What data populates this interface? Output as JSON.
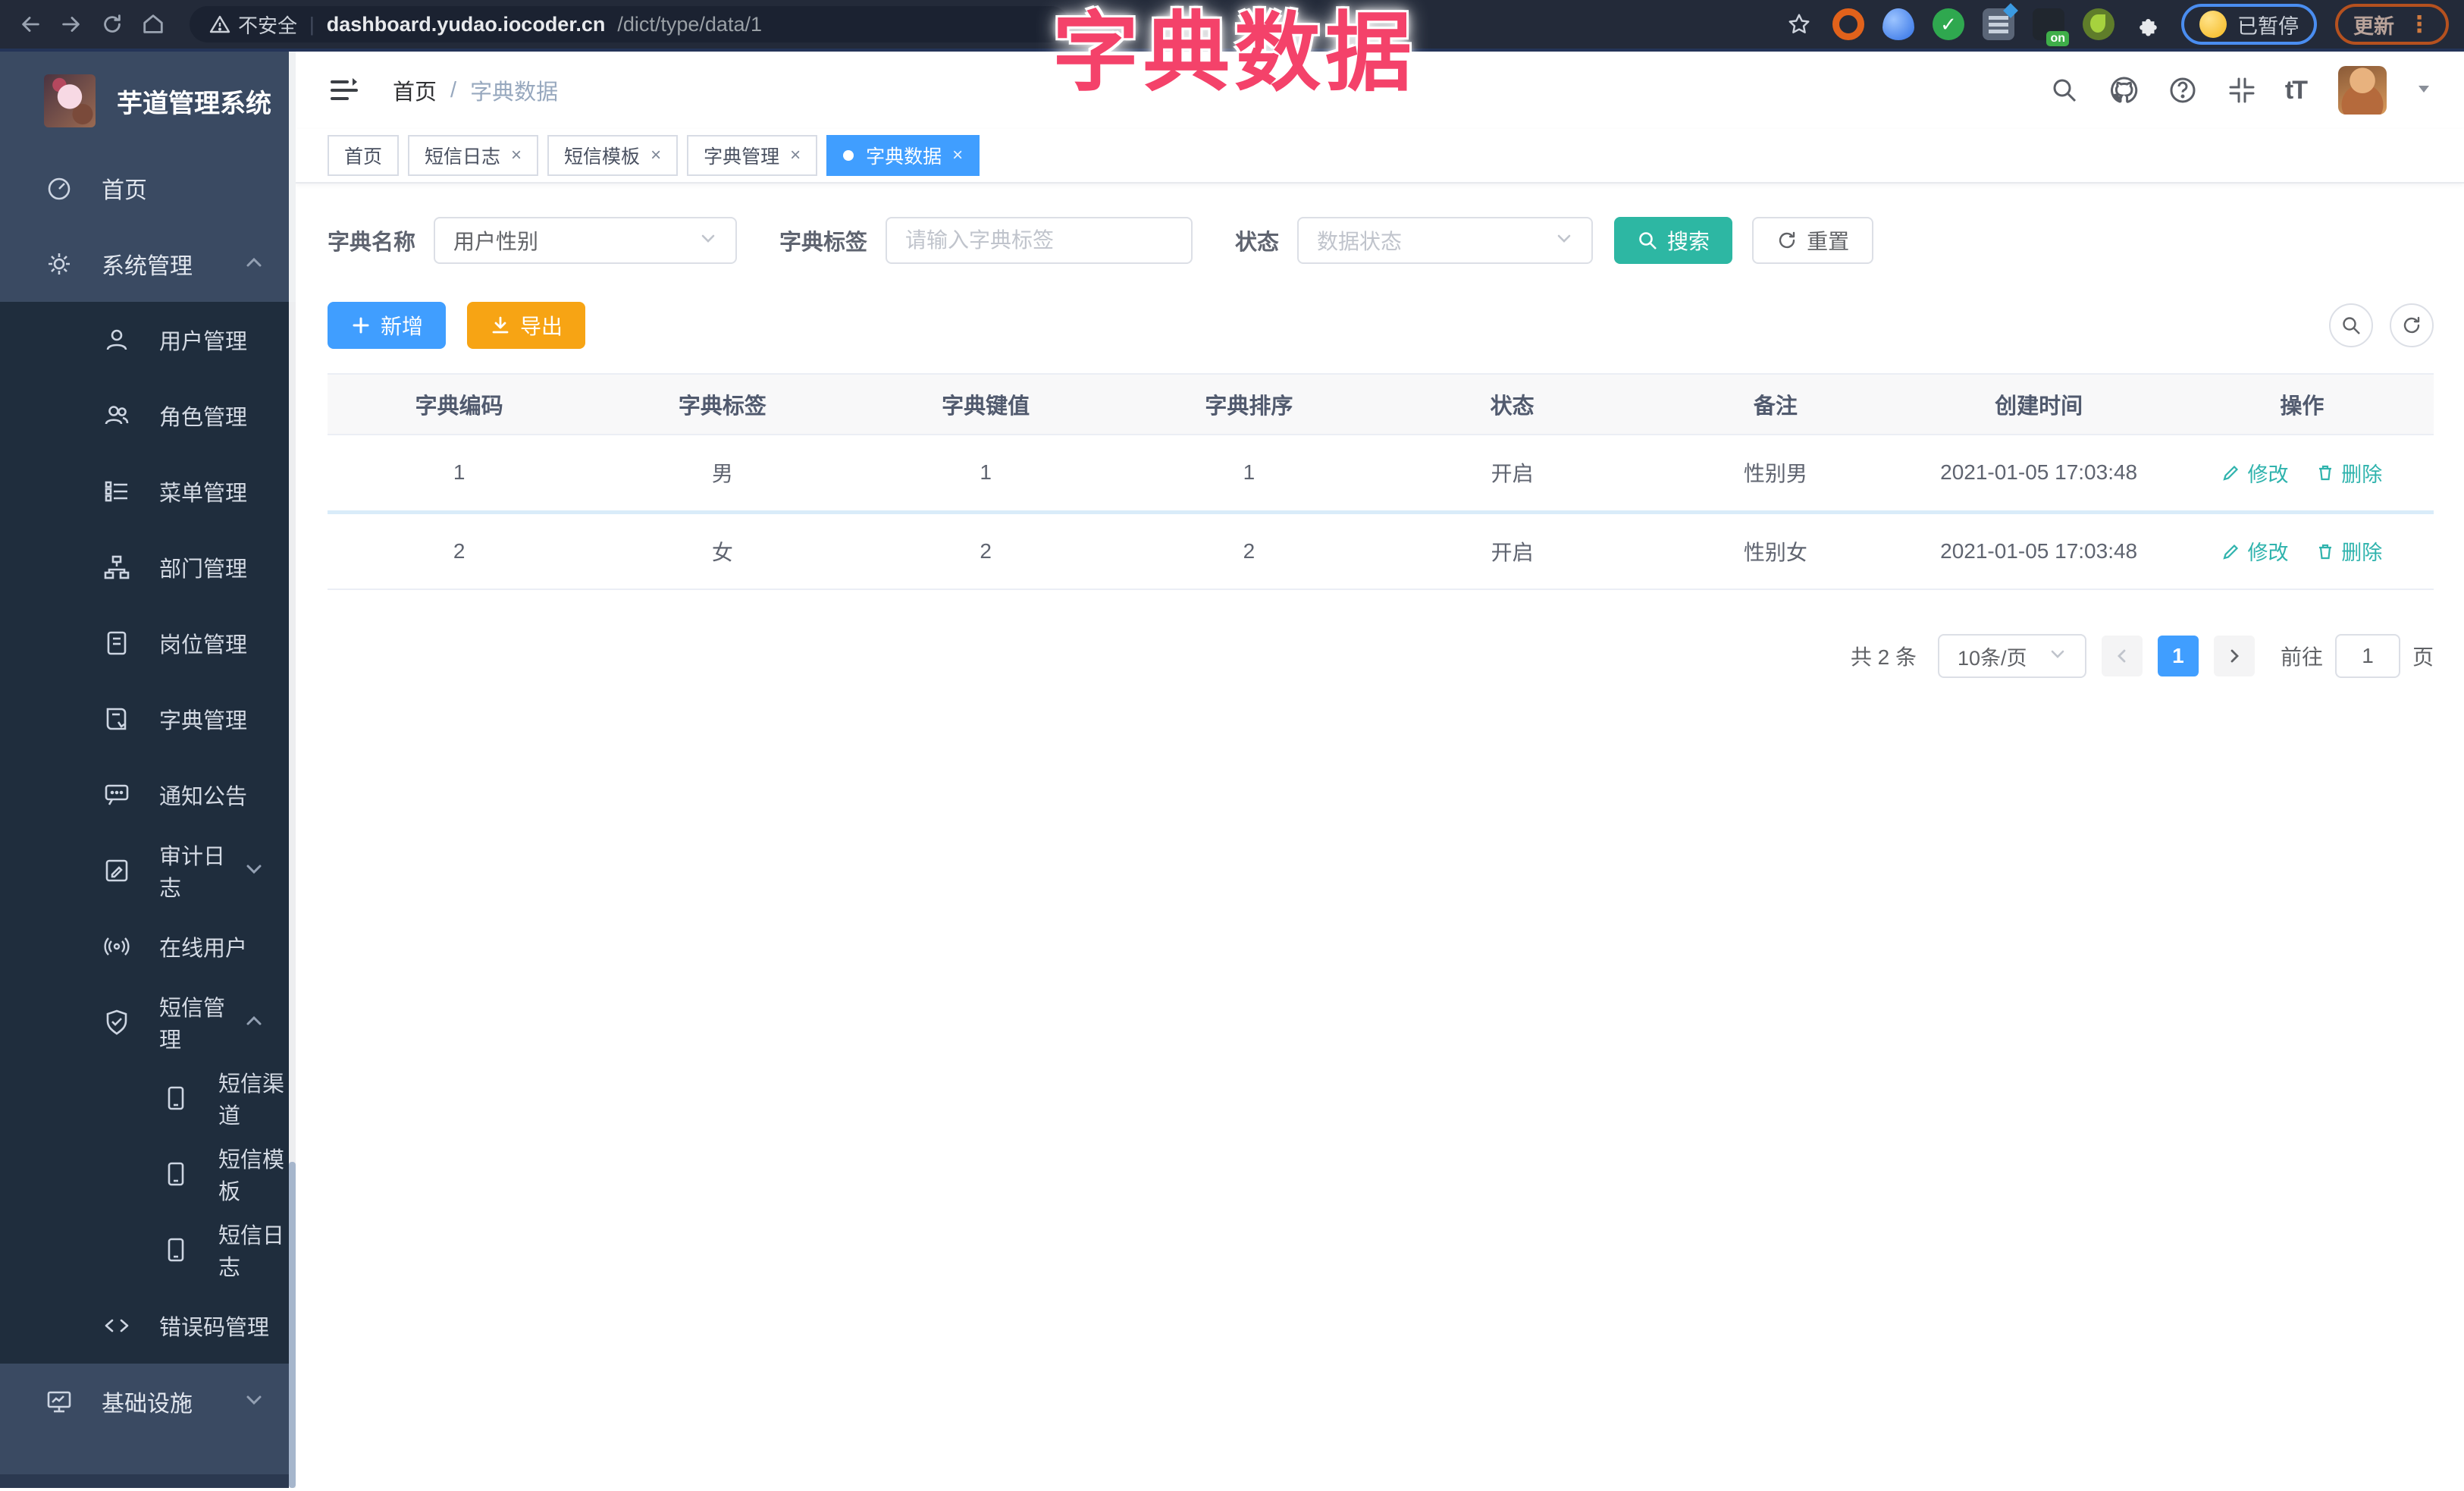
{
  "browser": {
    "security_label": "不安全",
    "url_host": "dashboard.yudao.iocoder.cn",
    "url_path": "/dict/type/data/1",
    "ext_on_badge": "on",
    "paused_label": "已暂停",
    "update_label": "更新"
  },
  "overlay": {
    "title": "字典数据"
  },
  "ui": {
    "close": "×",
    "sep": "|",
    "question": "?",
    "font_icon": "tT",
    "dots": "⋮",
    "slash": "/",
    "check": "✓"
  },
  "sidebar": {
    "app_title": "芋道管理系统",
    "items": [
      {
        "label": "首页",
        "icon": "dashboard-icon"
      },
      {
        "label": "系统管理",
        "icon": "gear-icon",
        "expanded": true
      },
      {
        "label": "用户管理",
        "icon": "user-icon"
      },
      {
        "label": "角色管理",
        "icon": "roles-icon"
      },
      {
        "label": "菜单管理",
        "icon": "menu-list-icon"
      },
      {
        "label": "部门管理",
        "icon": "org-tree-icon"
      },
      {
        "label": "岗位管理",
        "icon": "post-badge-icon"
      },
      {
        "label": "字典管理",
        "icon": "dict-book-icon"
      },
      {
        "label": "通知公告",
        "icon": "notice-icon"
      },
      {
        "label": "审计日志",
        "icon": "audit-log-icon",
        "collapsed": true
      },
      {
        "label": "在线用户",
        "icon": "online-user-icon"
      },
      {
        "label": "短信管理",
        "icon": "sms-shield-icon",
        "expanded": true
      },
      {
        "label": "短信渠道",
        "icon": "phone-icon"
      },
      {
        "label": "短信模板",
        "icon": "phone-icon"
      },
      {
        "label": "短信日志",
        "icon": "phone-icon"
      },
      {
        "label": "错误码管理",
        "icon": "code-icon"
      },
      {
        "label": "基础设施",
        "icon": "monitor-icon",
        "collapsed": true
      }
    ]
  },
  "breadcrumb": {
    "home": "首页",
    "sep": "/",
    "current": "字典数据"
  },
  "tabs": [
    {
      "label": "首页",
      "closable": false,
      "active": false
    },
    {
      "label": "短信日志",
      "closable": true,
      "active": false
    },
    {
      "label": "短信模板",
      "closable": true,
      "active": false
    },
    {
      "label": "字典管理",
      "closable": true,
      "active": false
    },
    {
      "label": "字典数据",
      "closable": true,
      "active": true
    }
  ],
  "filters": {
    "dict_name_label": "字典名称",
    "dict_name_value": "用户性别",
    "dict_label_label": "字典标签",
    "dict_label_placeholder": "请输入字典标签",
    "status_label": "状态",
    "status_placeholder": "数据状态",
    "search_label": "搜索",
    "reset_label": "重置"
  },
  "toolbar": {
    "add_label": "新增",
    "export_label": "导出"
  },
  "table": {
    "columns": [
      "字典编码",
      "字典标签",
      "字典键值",
      "字典排序",
      "状态",
      "备注",
      "创建时间",
      "操作"
    ],
    "rows": [
      {
        "code": "1",
        "label": "男",
        "value": "1",
        "sort": "1",
        "status": "开启",
        "remark": "性别男",
        "created": "2021-01-05 17:03:48",
        "edit": "修改",
        "del": "删除"
      },
      {
        "code": "2",
        "label": "女",
        "value": "2",
        "sort": "2",
        "status": "开启",
        "remark": "性别女",
        "created": "2021-01-05 17:03:48",
        "edit": "修改",
        "del": "删除"
      }
    ]
  },
  "pagination": {
    "total": "共 2 条",
    "page_size": "10条/页",
    "page": "1",
    "goto_label": "前往",
    "goto_value": "1",
    "page_unit": "页"
  },
  "colors": {
    "primary": "#409eff",
    "teal": "#2db7a3",
    "warning": "#f7a414",
    "pink": "#f4426a",
    "sidebar": "#3a4a62",
    "submenu": "#1f2d3d"
  }
}
